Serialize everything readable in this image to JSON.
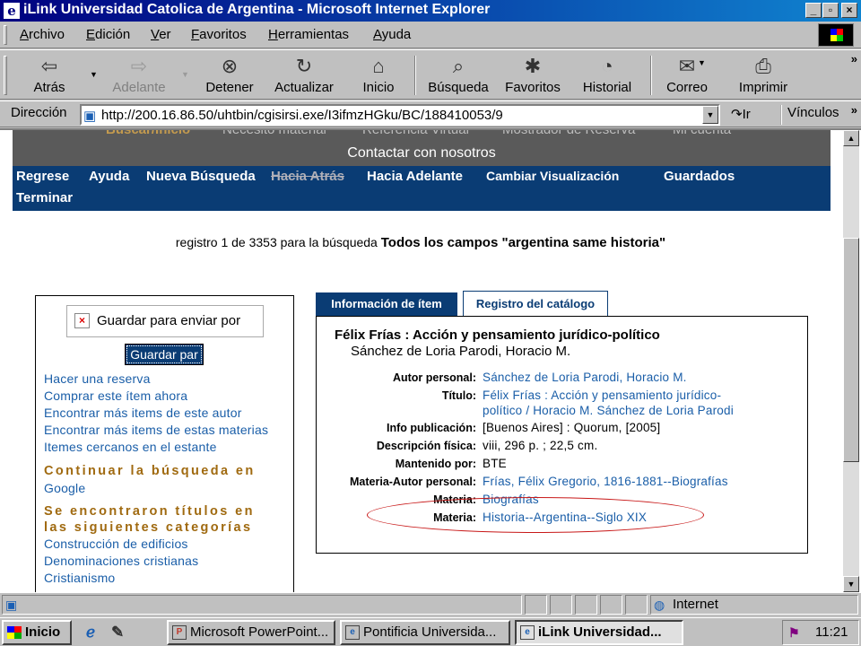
{
  "window": {
    "title": "iLink Universidad Catolica de Argentina - Microsoft Internet Explorer",
    "app_icon": "e",
    "minimize": "_",
    "maximize": "▫",
    "close": "×"
  },
  "menu": [
    "Archivo",
    "Edición",
    "Ver",
    "Favoritos",
    "Herramientas",
    "Ayuda"
  ],
  "toolbar": {
    "back": "Atrás",
    "forward": "Adelante",
    "stop": "Detener",
    "refresh": "Actualizar",
    "home": "Inicio",
    "search": "Búsqueda",
    "favorites": "Favoritos",
    "history": "Historial",
    "mail": "Correo",
    "print": "Imprimir",
    "more": "»"
  },
  "address": {
    "label": "Dirección",
    "url": "http://200.16.86.50/uhtbin/cgisirsi.exe/I3ifmzHGku/BC/188410053/9",
    "go": "Ir",
    "links": "Vínculos",
    "more": "»"
  },
  "page": {
    "top_nav_faded": [
      "Buscar/Inicio",
      "Necesito material",
      "Referencia Virtual",
      "Mostrador de Reserva",
      "Mi cuenta"
    ],
    "contact": "Contactar con nosotros",
    "nav": {
      "back": "Regrese",
      "help": "Ayuda",
      "new_search": "Nueva Búsqueda",
      "previous": "Hacia Atrás",
      "next": "Hacia Adelante",
      "change_view": "Cambiar Visualización",
      "saved": "Guardados",
      "logout": "Terminar"
    },
    "record_count_prefix": "registro 1 de 3353 para la búsqueda",
    "record_count_query": "Todos los campos \"argentina same historia\"",
    "left": {
      "save_select": "Guardar para enviar por",
      "save_button": "Guardar par",
      "links": [
        "Hacer una reserva",
        "Comprar este ítem ahora",
        "Encontrar más items de este autor",
        "Encontrar más items de estas materias",
        "Itemes cercanos en el estante"
      ],
      "continue_heading": "Continuar la búsqueda en",
      "google": "Google",
      "categories_heading_1": "Se encontraron títulos en",
      "categories_heading_2": "las siguientes categorías",
      "categories": [
        "Construcción de edificios",
        "Denominaciones cristianas",
        "Cristianismo"
      ]
    },
    "tabs": {
      "item_info": "Información de ítem",
      "catalog_record": "Registro del catálogo"
    },
    "record": {
      "title": "Félix Frías : Acción y pensamiento jurídico-político",
      "author": "Sánchez de Loria Parodi, Horacio M.",
      "fields": [
        {
          "label": "Autor personal:",
          "value": "Sánchez de Loria Parodi, Horacio M.",
          "link": true
        },
        {
          "label": "Título:",
          "value": "Félix Frías : Acción y pensamiento jurídico-",
          "link": true
        },
        {
          "label": "",
          "value": "político / Horacio M. Sánchez de Loria Parodi",
          "link": true
        },
        {
          "label": "Info publicación:",
          "value": "[Buenos Aires] : Quorum, [2005]",
          "link": false
        },
        {
          "label": "Descripción física:",
          "value": "viii, 296 p. ; 22,5 cm.",
          "link": false
        },
        {
          "label": "Mantenido por:",
          "value": "BTE",
          "link": false
        },
        {
          "label": "Materia-Autor personal:",
          "value": "Frías, Félix Gregorio, 1816-1881--Biografías",
          "link": true
        },
        {
          "label": "Materia:",
          "value": "Biografías",
          "link": true
        },
        {
          "label": "Materia:",
          "value": "Historia--Argentina--Siglo XIX",
          "link": true
        }
      ]
    }
  },
  "status": {
    "zone": "Internet"
  },
  "taskbar": {
    "start": "Inicio",
    "tasks": [
      {
        "label": "Microsoft PowerPoint...",
        "active": false
      },
      {
        "label": "Pontificia Universida...",
        "active": false
      },
      {
        "label": "iLink Universidad...",
        "active": true
      }
    ],
    "clock": "11:21"
  },
  "colors": {
    "title_bar": "#000080",
    "nav_blue": "#0a3c74",
    "link": "#1a5ea8",
    "heading_gold": "#a06a10",
    "highlight_ellipse": "#c81818"
  }
}
